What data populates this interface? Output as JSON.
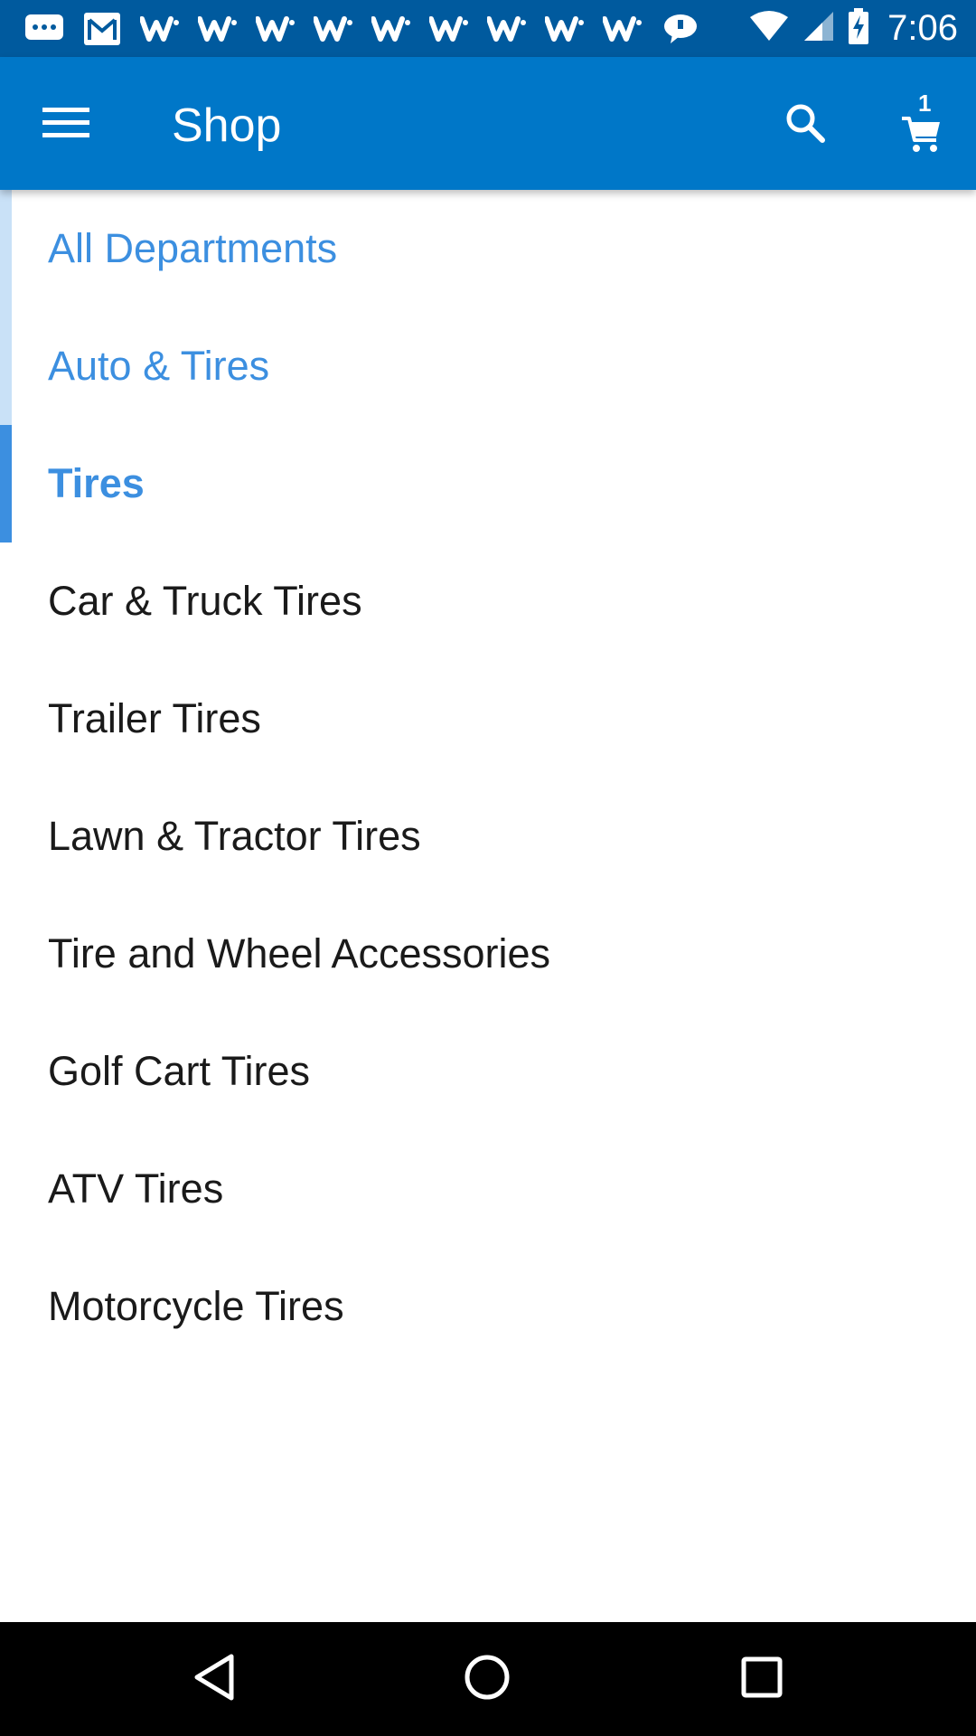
{
  "status_bar": {
    "time": "7:06",
    "notification_icons": [
      "chat-bubble-icon",
      "gmail-icon",
      "walmart-icon",
      "walmart-icon",
      "walmart-icon",
      "walmart-icon",
      "walmart-icon",
      "walmart-icon",
      "walmart-icon",
      "walmart-icon",
      "walmart-icon",
      "message-icon"
    ],
    "system_icons": [
      "wifi-icon",
      "cell-signal-icon",
      "battery-charging-icon"
    ]
  },
  "app_bar": {
    "title": "Shop",
    "cart_count": "1",
    "color": "#0077c8"
  },
  "category_list": {
    "breadcrumbs": [
      {
        "label": "All Departments"
      },
      {
        "label": "Auto & Tires"
      }
    ],
    "current": {
      "label": "Tires"
    },
    "items": [
      {
        "label": "Car & Truck Tires"
      },
      {
        "label": "Trailer Tires"
      },
      {
        "label": "Lawn & Tractor Tires"
      },
      {
        "label": "Tire and Wheel Accessories"
      },
      {
        "label": "Golf Cart Tires"
      },
      {
        "label": "ATV Tires"
      },
      {
        "label": "Motorcycle Tires"
      }
    ],
    "accent_color": "#3c8fe0"
  },
  "nav_bar": {
    "buttons": [
      "back-icon",
      "home-icon",
      "recents-icon"
    ]
  }
}
